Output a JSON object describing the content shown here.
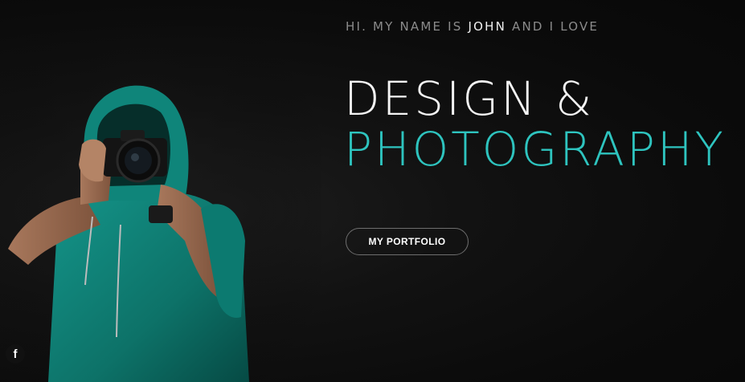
{
  "hero": {
    "intro": {
      "prefix": "HI. MY NAME IS ",
      "name": "JOHN",
      "suffix": " AND I LOVE"
    },
    "title_line_1": "DESIGN &",
    "title_line_2": "PHOTOGRAPHY",
    "cta_label": "MY PORTFOLIO",
    "photo_description_icon": "photographer-image"
  },
  "social": {
    "facebook_glyph": "f",
    "facebook_icon": "facebook-icon"
  },
  "colors": {
    "background": "#0d0d0d",
    "accent": "#2ec4bf",
    "heading": "#f4f4f4",
    "muted": "#8b8b8b",
    "hoodie": "#0f7f74"
  }
}
